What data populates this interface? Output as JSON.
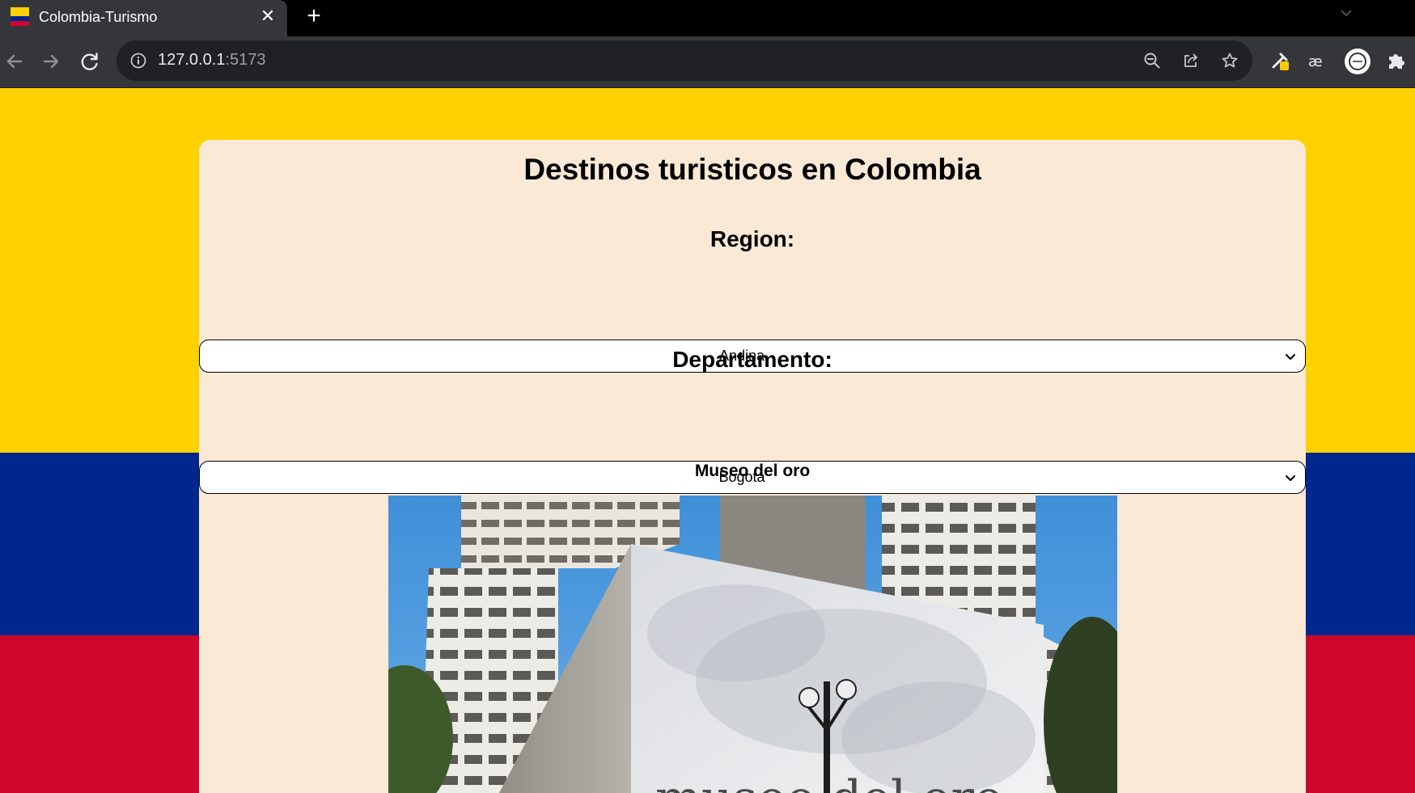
{
  "browser": {
    "tab_title": "Colombia-Turismo",
    "tab_close_glyph": "✕",
    "new_tab_glyph": "+",
    "url_host": "127.0.0.1",
    "url_port": ":5173",
    "icons": {
      "back": "back-arrow-icon",
      "forward": "forward-arrow-icon",
      "reload": "reload-icon",
      "site_info": "info-icon",
      "zoom": "zoom-out-icon",
      "share": "share-icon",
      "bookmark": "star-icon",
      "extension_1": "eyedropper-icon",
      "extension_2": "ae-icon",
      "extension_3": "profile-icon",
      "extensions": "puzzle-icon"
    }
  },
  "page": {
    "title": "Destinos turisticos en Colombia",
    "region": {
      "label": "Region:",
      "selected": "Andina"
    },
    "departamento": {
      "label": "Departamento:",
      "selected": "Bogotá"
    },
    "destination": {
      "name": "Museo del oro",
      "photo_sign_text": "museo del oro"
    }
  },
  "colors": {
    "flag_yellow": "#ffd100",
    "flag_blue": "#00278c",
    "flag_red": "#ce062e",
    "card_background": "#fae9d5",
    "chrome_dark": "#35363a",
    "omnibox": "#202124"
  }
}
